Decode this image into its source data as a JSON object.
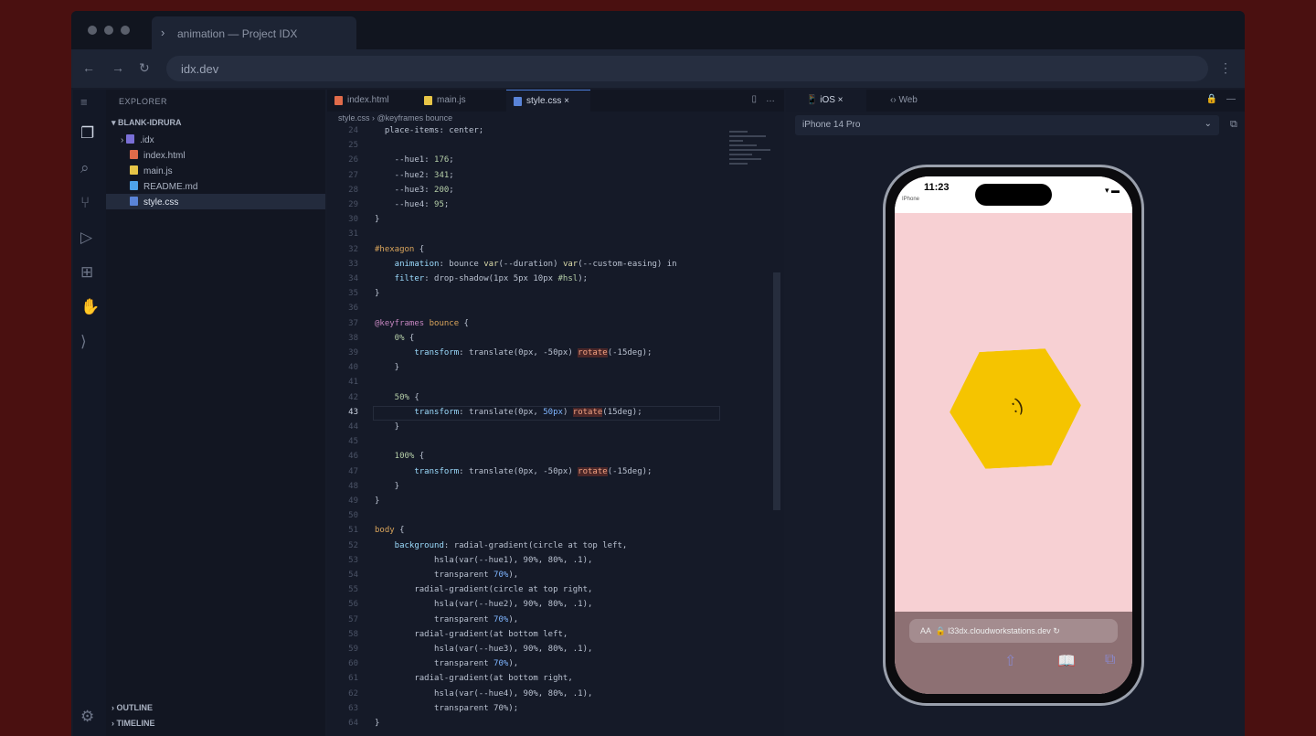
{
  "browser": {
    "tab_title": "animation — Project IDX",
    "url": "idx.dev"
  },
  "explorer": {
    "header": "EXPLORER",
    "root": "BLANK-IDRURA",
    "items": [
      {
        "name": ".idx",
        "color": "#7a6fd6"
      },
      {
        "name": "index.html",
        "color": "#e06b4a"
      },
      {
        "name": "main.js",
        "color": "#e7c547"
      },
      {
        "name": "README.md",
        "color": "#4ea2e8"
      },
      {
        "name": "style.css",
        "color": "#5a84d8"
      }
    ],
    "outline": "OUTLINE",
    "timeline": "TIMELINE"
  },
  "editor": {
    "tabs": [
      {
        "label": "index.html",
        "color": "#e06b4a"
      },
      {
        "label": "main.js",
        "color": "#e7c547"
      },
      {
        "label": "style.css",
        "color": "#5a84d8"
      }
    ],
    "breadcrumb": [
      "style.css",
      "@keyframes bounce"
    ],
    "current_line": "43",
    "lines": [
      [
        "24",
        [
          [
            "  place-items: center;",
            ""
          ]
        ]
      ],
      [
        "25",
        [
          [
            "",
            ""
          ]
        ]
      ],
      [
        "26",
        [
          [
            "    --hue1",
            ""
          ],
          [
            ": ",
            ""
          ],
          [
            "176",
            "n"
          ],
          [
            ";",
            ""
          ]
        ]
      ],
      [
        "27",
        [
          [
            "    --hue2",
            ""
          ],
          [
            ": ",
            ""
          ],
          [
            "341",
            "n"
          ],
          [
            ";",
            ""
          ]
        ]
      ],
      [
        "28",
        [
          [
            "    --hue3",
            ""
          ],
          [
            ": ",
            ""
          ],
          [
            "200",
            "n"
          ],
          [
            ";",
            ""
          ]
        ]
      ],
      [
        "29",
        [
          [
            "    --hue4",
            ""
          ],
          [
            ": ",
            ""
          ],
          [
            "95",
            "n"
          ],
          [
            ";",
            ""
          ]
        ]
      ],
      [
        "30",
        [
          [
            "}",
            ""
          ]
        ]
      ],
      [
        "31",
        [
          [
            "",
            ""
          ]
        ]
      ],
      [
        "32",
        [
          [
            "#hexagon",
            "p"
          ],
          [
            " {",
            ""
          ]
        ]
      ],
      [
        "33",
        [
          [
            "    animation",
            "f"
          ],
          [
            ": bounce ",
            ""
          ],
          [
            "var",
            "v"
          ],
          [
            "(--duration) ",
            ""
          ],
          [
            "var",
            "v"
          ],
          [
            "(--custom-easing) in",
            ""
          ]
        ]
      ],
      [
        "34",
        [
          [
            "    filter",
            "f"
          ],
          [
            ": drop-shadow(1px 5px 10px ",
            ""
          ],
          [
            "#hsl",
            "n"
          ],
          [
            ");",
            ""
          ]
        ]
      ],
      [
        "35",
        [
          [
            "}",
            ""
          ]
        ]
      ],
      [
        "36",
        [
          [
            "",
            ""
          ]
        ]
      ],
      [
        "37",
        [
          [
            "@keyframes",
            "k"
          ],
          [
            " bounce",
            "p"
          ],
          [
            " {",
            ""
          ]
        ]
      ],
      [
        "38",
        [
          [
            "    0%",
            "n"
          ],
          [
            " {",
            ""
          ]
        ]
      ],
      [
        "39",
        [
          [
            "        transform",
            "f"
          ],
          [
            ": translate(0px, -50px) ",
            ""
          ],
          [
            "rotate",
            "r"
          ],
          [
            "(-15deg);",
            ""
          ]
        ]
      ],
      [
        "40",
        [
          [
            "    }",
            ""
          ]
        ]
      ],
      [
        "41",
        [
          [
            "",
            ""
          ]
        ]
      ],
      [
        "42",
        [
          [
            "    50%",
            "n"
          ],
          [
            " {",
            ""
          ]
        ]
      ],
      [
        "43",
        [
          [
            "        transform",
            "f"
          ],
          [
            ": translate(0px, ",
            ""
          ],
          [
            "50px",
            "s"
          ],
          [
            ") ",
            ""
          ],
          [
            "rotate",
            "r"
          ],
          [
            "(15deg);",
            ""
          ]
        ]
      ],
      [
        "44",
        [
          [
            "    }",
            ""
          ]
        ]
      ],
      [
        "45",
        [
          [
            "",
            ""
          ]
        ]
      ],
      [
        "46",
        [
          [
            "    100%",
            "n"
          ],
          [
            " {",
            ""
          ]
        ]
      ],
      [
        "47",
        [
          [
            "        transform",
            "f"
          ],
          [
            ": translate(0px, -50px) ",
            ""
          ],
          [
            "rotate",
            "r"
          ],
          [
            "(-15deg);",
            ""
          ]
        ]
      ],
      [
        "48",
        [
          [
            "    }",
            ""
          ]
        ]
      ],
      [
        "49",
        [
          [
            "}",
            ""
          ]
        ]
      ],
      [
        "50",
        [
          [
            "",
            ""
          ]
        ]
      ],
      [
        "51",
        [
          [
            "body",
            "p"
          ],
          [
            " {",
            ""
          ]
        ]
      ],
      [
        "52",
        [
          [
            "    background",
            "f"
          ],
          [
            ": radial-gradient(circle at top left,",
            ""
          ]
        ]
      ],
      [
        "53",
        [
          [
            "            hsla(var(--hue1), 90%, 80%, .1),",
            ""
          ]
        ]
      ],
      [
        "54",
        [
          [
            "            transparent ",
            ""
          ],
          [
            "70%",
            "s"
          ],
          [
            "),",
            ""
          ]
        ]
      ],
      [
        "55",
        [
          [
            "        radial-gradient(circle at top right,",
            ""
          ]
        ]
      ],
      [
        "56",
        [
          [
            "            hsla(var(--hue2), 90%, 80%, .1),",
            ""
          ]
        ]
      ],
      [
        "57",
        [
          [
            "            transparent ",
            ""
          ],
          [
            "70%",
            "s"
          ],
          [
            "),",
            ""
          ]
        ]
      ],
      [
        "58",
        [
          [
            "        radial-gradient(at bottom left,",
            ""
          ]
        ]
      ],
      [
        "59",
        [
          [
            "            hsla(var(--hue3), 90%, 80%, .1),",
            ""
          ]
        ]
      ],
      [
        "60",
        [
          [
            "            transparent ",
            ""
          ],
          [
            "70%",
            "s"
          ],
          [
            "),",
            ""
          ]
        ]
      ],
      [
        "61",
        [
          [
            "        radial-gradient(at bottom right,",
            ""
          ]
        ]
      ],
      [
        "62",
        [
          [
            "            hsla(var(--hue4), 90%, 80%, .1),",
            ""
          ]
        ]
      ],
      [
        "63",
        [
          [
            "            transparent 70%);",
            ""
          ]
        ]
      ],
      [
        "64",
        [
          [
            "}",
            ""
          ]
        ]
      ]
    ]
  },
  "preview": {
    "tabs": [
      "iOS",
      "Web"
    ],
    "device": "iPhone 14 Pro",
    "time": "11:23",
    "carrier": "IPhone",
    "phone_url": "l33dx.cloudworkstations.dev",
    "aa": "AA",
    "face": ":)"
  }
}
